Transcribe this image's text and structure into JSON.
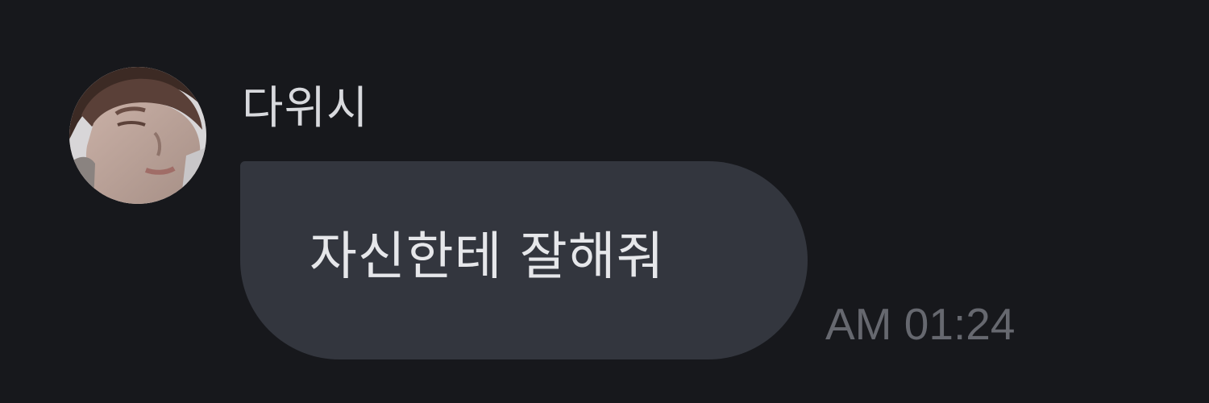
{
  "message": {
    "sender_name": "다위시",
    "avatar_icon": "profile-photo-avatar",
    "text": "자신한테 잘해줘",
    "timestamp": "AM 01:24"
  },
  "colors": {
    "background": "#17181c",
    "bubble": "#33363e",
    "name_text": "#d8d9dd",
    "message_text": "#e6e7ea",
    "timestamp_text": "#66686f"
  }
}
